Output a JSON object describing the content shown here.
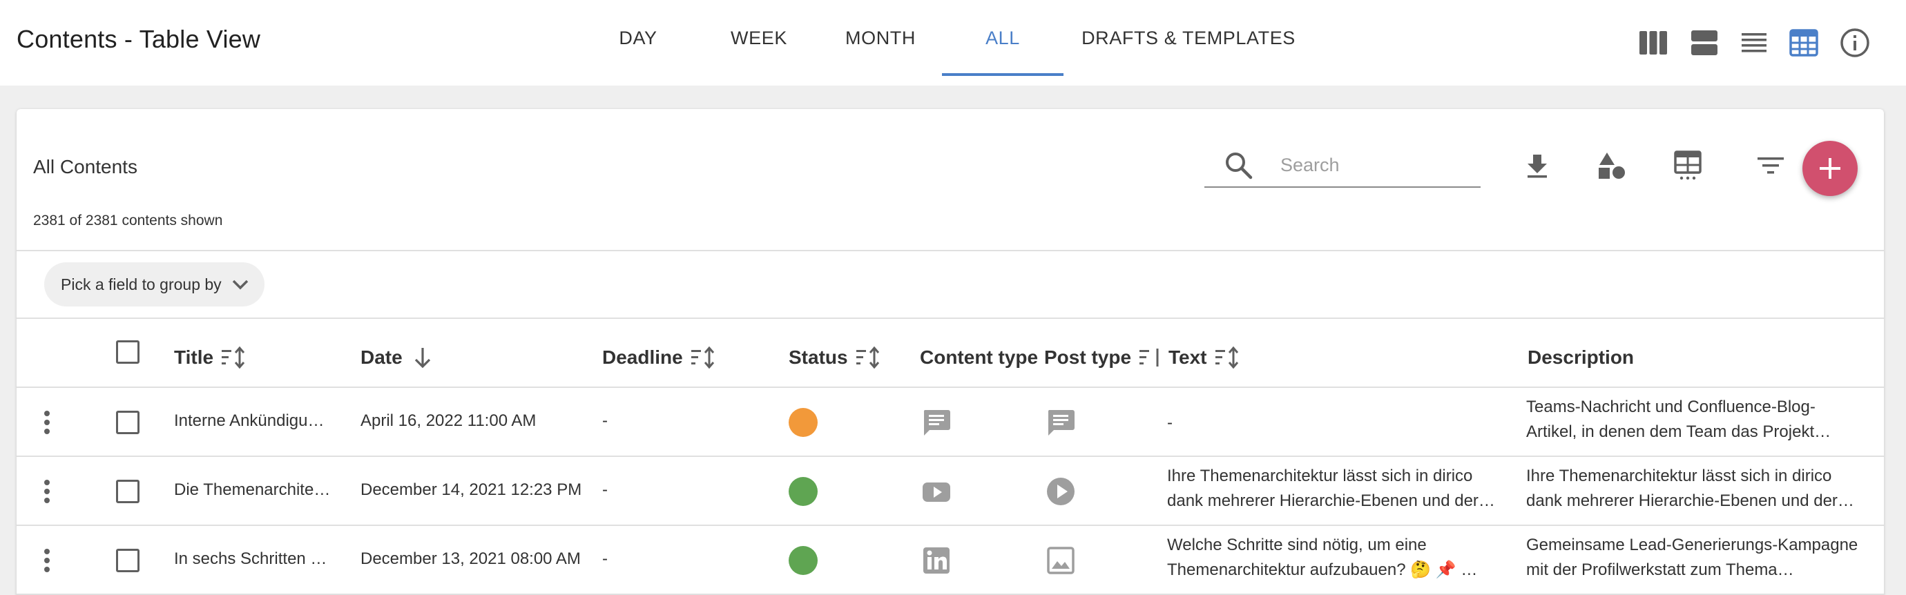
{
  "header": {
    "title": "Contents - Table View",
    "tabs": [
      {
        "label": "DAY"
      },
      {
        "label": "WEEK"
      },
      {
        "label": "MONTH"
      },
      {
        "label": "ALL"
      },
      {
        "label": "DRAFTS & TEMPLATES"
      }
    ],
    "active_tab": "ALL",
    "view_icons": [
      "columns-view-icon",
      "agenda-view-icon",
      "list-view-icon",
      "table-view-icon",
      "info-icon"
    ]
  },
  "colors": {
    "accent": "#4a7fc8",
    "fab": "#d1506e",
    "status_orange": "#f2993a",
    "status_green": "#5fa552",
    "icon_gray": "#9e9e9e"
  },
  "card": {
    "title": "All Contents",
    "count_text": "2381 of 2381 contents shown",
    "search": {
      "placeholder": "Search",
      "value": ""
    },
    "toolbar_icons": [
      "download-icon",
      "shapes-icon",
      "table-columns-icon",
      "filter-icon",
      "add-icon"
    ],
    "group_by_label": "Pick a field to group by"
  },
  "table": {
    "columns": [
      {
        "label": "Title",
        "sort": "sortable"
      },
      {
        "label": "Date",
        "sort": "descending"
      },
      {
        "label": "Deadline",
        "sort": "sortable"
      },
      {
        "label": "Status",
        "sort": "sortable"
      },
      {
        "label": "Content type",
        "sort": "none"
      },
      {
        "label": "Post type",
        "sort": "sortable"
      },
      {
        "label": "Text",
        "sort": "sortable"
      },
      {
        "label": "Description",
        "sort": "none"
      }
    ],
    "rows": [
      {
        "title": "Interne Ankündigu…",
        "date": "April 16, 2022 11:00 AM",
        "deadline": "-",
        "status": "orange",
        "content_type_icon": "message-icon",
        "post_type_icon": "message-icon",
        "text": [
          "-",
          ""
        ],
        "description": [
          "Teams-Nachricht und Confluence-Blog-",
          "Artikel, in denen dem Team das Projekt…"
        ]
      },
      {
        "title": "Die Themenarchite…",
        "date": "December 14, 2021 12:23 PM",
        "deadline": "-",
        "status": "green",
        "content_type_icon": "youtube-icon",
        "post_type_icon": "play-icon",
        "text": [
          "Ihre Themenarchitektur lässt sich in dirico",
          "dank mehrerer Hierarchie-Ebenen und der…"
        ],
        "description": [
          "Ihre Themenarchitektur lässt sich in dirico",
          "dank mehrerer Hierarchie-Ebenen und der…"
        ]
      },
      {
        "title": "In sechs Schritten …",
        "date": "December 13, 2021 08:00 AM",
        "deadline": "-",
        "status": "green",
        "content_type_icon": "linkedin-icon",
        "post_type_icon": "image-icon",
        "text": [
          "Welche Schritte sind nötig, um eine",
          "Themenarchitektur aufzubauen? 🤔 📌 …"
        ],
        "description": [
          "Gemeinsame Lead-Generierungs-Kampagne",
          "mit der Profilwerkstatt zum Thema…"
        ]
      }
    ]
  }
}
